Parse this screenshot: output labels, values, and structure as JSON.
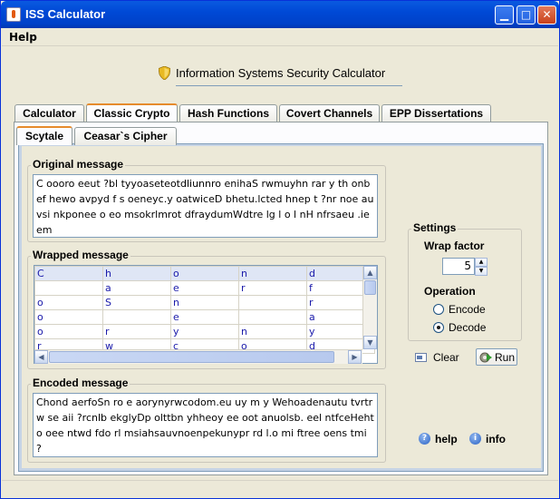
{
  "window": {
    "title": "ISS Calculator"
  },
  "menu": {
    "help_label": "Help"
  },
  "header": {
    "title": "Information Systems Security Calculator"
  },
  "tabs": {
    "main": [
      "Calculator",
      "Classic Crypto",
      "Hash Functions",
      "Covert Channels",
      "EPP Dissertations"
    ],
    "active_main": "Classic Crypto",
    "sub": [
      "Scytale",
      "Ceasar`s Cipher"
    ],
    "active_sub": "Scytale"
  },
  "original": {
    "title": "Original message",
    "text": "C oooro  eeut ?bl tyyoaseteotdliunnro enihaS rwmuyhn rar y th onbef hewo avpyd f s oeneyc.y oatwiceD bhetu.lcted  hnep  t  ?nr  noe  auvsi nkponee o  eo    msokrlmrot dfraydumWdtre lg l o   l nH nfrsaeu .ieem"
  },
  "wrapped": {
    "title": "Wrapped message",
    "rows": [
      [
        "C",
        "h",
        "o",
        "n",
        "d"
      ],
      [
        "",
        "a",
        "e",
        "r",
        "f"
      ],
      [
        "o",
        "S",
        "n",
        "",
        "r"
      ],
      [
        "o",
        "",
        "e",
        "",
        "a"
      ],
      [
        "o",
        "r",
        "y",
        "n",
        "y"
      ],
      [
        "r",
        "w",
        "c",
        "o",
        "d"
      ]
    ]
  },
  "encoded": {
    "title": "Encoded message",
    "text": "Chond aerfoSn ro e aorynyrwcodom.eu uy m y  Wehoadenautu tvrtrw se aii ?rcnlb ekglyDp    olttbn yhheoy ee oot  anuolsb.  eel ntfceHehto oee ntwd fdo  rl  msiahsauvnoenpekunypr rd l.o  mi ftree  oens tmi ?"
  },
  "settings": {
    "title": "Settings",
    "wrap_label": "Wrap factor",
    "wrap_value": "5",
    "operation_label": "Operation",
    "encode_label": "Encode",
    "decode_label": "Decode",
    "selected": "Decode"
  },
  "actions": {
    "clear_label": "Clear",
    "run_label": "Run",
    "help_label": "help",
    "info_label": "info"
  }
}
